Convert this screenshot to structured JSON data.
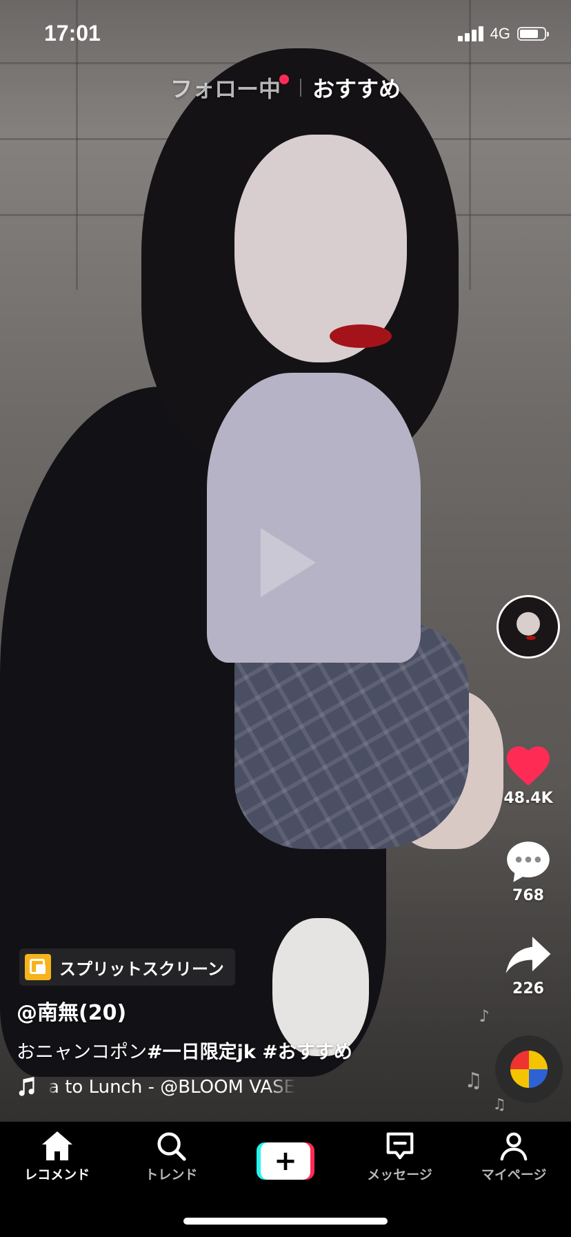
{
  "status_bar": {
    "time": "17:01",
    "network": "4G",
    "battery_level": 0.75
  },
  "top_tabs": {
    "following": "フォロー中",
    "recommended": "おすすめ"
  },
  "rail": {
    "likes": "48.4K",
    "comments": "768",
    "shares": "226"
  },
  "post": {
    "effect_label": "スプリットスクリーン",
    "username": "@南無(20)",
    "caption_text": "おニャンコポン",
    "caption_tags": "#一日限定jk #おすすめ",
    "sound": "a to Lunch - @BLOOM VASE"
  },
  "nav": {
    "home": "レコメンド",
    "trend": "トレンド",
    "create": "+",
    "messages": "メッセージ",
    "profile": "マイページ"
  },
  "colors": {
    "like": "#fe2c55",
    "create_left": "#25f4ee",
    "create_right": "#fe2c55",
    "effect": "#f6b31b"
  }
}
